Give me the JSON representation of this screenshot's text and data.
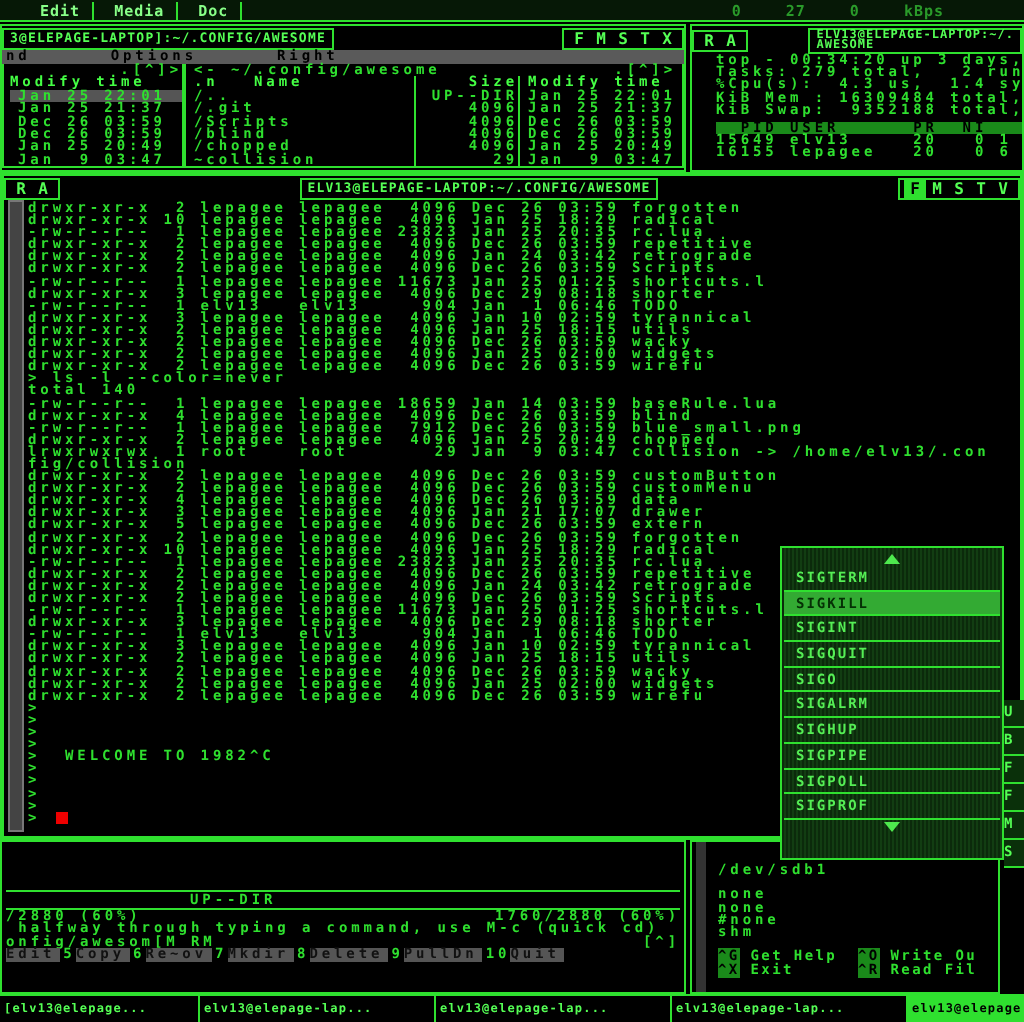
{
  "top_bar": {
    "menus": [
      {
        "label": "Edit"
      },
      {
        "label": "Media"
      },
      {
        "label": "Doc"
      }
    ],
    "indicators": [
      "0",
      "27",
      "0",
      "kBps"
    ]
  },
  "file_manager": {
    "title": "3@ELEPAGE-LAPTOP]:~/.CONFIG/AWESOME",
    "buttons": [
      "F",
      "M",
      "S",
      "T",
      "X"
    ],
    "menu": [
      "nd",
      "Options",
      "Right"
    ],
    "left_panel": {
      "header": ".[^]>",
      "column": "Modify time",
      "rows": [
        {
          "text": "Jan 25 22:01",
          "selected": true
        },
        {
          "text": "Jan 25 21:37",
          "selected": false
        },
        {
          "text": "Dec 26 03:59",
          "selected": false
        },
        {
          "text": "Dec 26 03:59",
          "selected": false
        },
        {
          "text": "Jan 25 20:49",
          "selected": false
        },
        {
          "text": "Jan  9 03:47",
          "selected": false
        }
      ]
    },
    "right_panel": {
      "path": "<- ~/.config/awesome",
      "header": ".[^]>",
      "columns": [
        ".n",
        "Name",
        "Size",
        "Modify time"
      ],
      "rows": [
        {
          "name": "/..",
          "size": "UP--DIR",
          "time": "Jan 25 22:01"
        },
        {
          "name": "/.git",
          "size": "4096",
          "time": "Jan 25 21:37"
        },
        {
          "name": "/Scripts",
          "size": "4096",
          "time": "Dec 26 03:59"
        },
        {
          "name": "/blind",
          "size": "4096",
          "time": "Dec 26 03:59"
        },
        {
          "name": "/chopped",
          "size": "4096",
          "time": "Jan 25 20:49"
        },
        {
          "name": "~collision",
          "size": "29",
          "time": "Jan  9 03:47"
        }
      ]
    }
  },
  "process_monitor": {
    "buttons": [
      "R",
      "A"
    ],
    "title": "ELV13@ELEPAGE-LAPTOP:~/.",
    "title_2": "AWESOME",
    "lines": [
      "top - 00:34:20 up 3 days,",
      "Tasks: 279 total,   2 run",
      "%Cpu(s):  4.3 us,  1.4 sy",
      "KiB Mem : 16309484 total,",
      "KiB Swap:  9352188 total,"
    ],
    "table_header": "  PID USER      PR  NI",
    "rows": [
      "15649 elv13     20   0 1",
      "16155 lepagee   20   0 6"
    ]
  },
  "terminal": {
    "buttons_left": [
      "R",
      "A"
    ],
    "title": "ELV13@ELEPAGE-LAPTOP:~/.CONFIG/AWESOME",
    "buttons_right": [
      {
        "label": "F",
        "selected": true
      },
      {
        "label": "M",
        "selected": false
      },
      {
        "label": "S",
        "selected": false
      },
      {
        "label": "T",
        "selected": false
      },
      {
        "label": "V",
        "selected": false
      }
    ],
    "lines": [
      "drwxr-xr-x  2 lepagee lepagee  4096 Dec 26 03:59 forgotten",
      "drwxr-xr-x 10 lepagee lepagee  4096 Jan 25 18:29 radical",
      "-rw-r--r--  1 lepagee lepagee 23823 Jan 25 20:35 rc.lua",
      "drwxr-xr-x  2 lepagee lepagee  4096 Dec 26 03:59 repetitive",
      "drwxr-xr-x  2 lepagee lepagee  4096 Jan 24 03:42 retrograde",
      "drwxr-xr-x  2 lepagee lepagee  4096 Dec 26 03:59 Scripts",
      "-rw-r--r--  1 lepagee lepagee 11673 Jan 25 01:25 shortcuts.l",
      "drwxr-xr-x  3 lepagee lepagee  4096 Dec 29 08:18 shorter",
      "-rw-r--r--  1 elv13   elv13     904 Jan  1 06:46 TODO",
      "drwxr-xr-x  3 lepagee lepagee  4096 Jan 10 02:59 tyrannical",
      "drwxr-xr-x  2 lepagee lepagee  4096 Jan 25 18:15 utils",
      "drwxr-xr-x  2 lepagee lepagee  4096 Dec 26 03:59 wacky",
      "drwxr-xr-x  2 lepagee lepagee  4096 Jan 25 02:00 widgets",
      "drwxr-xr-x  2 lepagee lepagee  4096 Dec 26 03:59 wirefu",
      "> ls -l --color=never",
      "total 140",
      "-rw-r--r--  1 lepagee lepagee 18659 Jan 14 03:59 baseRule.lua",
      "drwxr-xr-x  4 lepagee lepagee  4096 Dec 26 03:59 blind",
      "-rw-r--r--  1 lepagee lepagee  7912 Dec 26 03:59 blue_small.png",
      "drwxr-xr-x  2 lepagee lepagee  4096 Jan 25 20:49 chopped",
      "lrwxrwxrwx  1 root    root       29 Jan  9 03:47 collision -> /home/elv13/.con",
      "fig/collision",
      "drwxr-xr-x  2 lepagee lepagee  4096 Dec 26 03:59 customButton",
      "drwxr-xr-x  2 lepagee lepagee  4096 Dec 26 03:59 customMenu",
      "drwxr-xr-x  4 lepagee lepagee  4096 Dec 26 03:59 data",
      "drwxr-xr-x  3 lepagee lepagee  4096 Jan 21 17:07 drawer",
      "drwxr-xr-x  5 lepagee lepagee  4096 Dec 26 03:59 extern",
      "drwxr-xr-x  2 lepagee lepagee  4096 Dec 26 03:59 forgotten",
      "drwxr-xr-x 10 lepagee lepagee  4096 Jan 25 18:29 radical",
      "-rw-r--r--  1 lepagee lepagee 23823 Jan 25 20:35 rc.lua",
      "drwxr-xr-x  2 lepagee lepagee  4096 Dec 26 03:59 repetitive",
      "drwxr-xr-x  2 lepagee lepagee  4096 Jan 24 03:42 retrograde",
      "drwxr-xr-x  2 lepagee lepagee  4096 Dec 26 03:59 Scripts",
      "-rw-r--r--  1 lepagee lepagee 11673 Jan 25 01:25 shortcuts.l",
      "drwxr-xr-x  3 lepagee lepagee  4096 Dec 29 08:18 shorter",
      "-rw-r--r--  1 elv13   elv13     904 Jan  1 06:46 TODO",
      "drwxr-xr-x  3 lepagee lepagee  4096 Jan 10 02:59 tyrannical",
      "drwxr-xr-x  2 lepagee lepagee  4096 Jan 25 18:15 utils",
      "drwxr-xr-x  2 lepagee lepagee  4096 Dec 26 03:59 wacky",
      "drwxr-xr-x  2 lepagee lepagee  4096 Jan 25 02:00 widgets",
      "drwxr-xr-x  2 lepagee lepagee  4096 Dec 26 03:59 wirefu",
      ">",
      ">",
      ">",
      ">",
      ">  WELCOME TO 1982^C",
      ">",
      ">",
      ">",
      ">"
    ],
    "prompt": ">",
    "cursor": true
  },
  "file_manager_footer": {
    "panel_right_info": "UP--DIR",
    "panel_left_status": "/2880 (60%)",
    "panel_right_status": "1760/2880 (60%)",
    "hint": " halfway through typing a command, use M-c (quick cd)",
    "command_line": "onfig/awesom[M RM",
    "command_suffix": "[^]",
    "function_keys": [
      {
        "label": "Edit"
      },
      {
        "number": "5",
        "label": "Copy"
      },
      {
        "number": "6",
        "label": "Re~ov"
      },
      {
        "number": "7",
        "label": "Mkdir"
      },
      {
        "number": "8",
        "label": "Delete"
      },
      {
        "number": "9",
        "label": "PullDn"
      },
      {
        "number": "10",
        "label": "Quit"
      }
    ]
  },
  "editor": {
    "lines": [
      "/dev/sdb1",
      "none",
      "none",
      "#none",
      "shm"
    ],
    "shortcuts": [
      {
        "key": "^G",
        "label": "Get Help"
      },
      {
        "key": "^O",
        "label": "Write Ou"
      },
      {
        "key": "^X",
        "label": "Exit"
      },
      {
        "key": "^R",
        "label": "Read Fil"
      }
    ]
  },
  "signal_menu": {
    "items": [
      {
        "label": "SIGTERM",
        "selected": false
      },
      {
        "label": "SIGKILL",
        "selected": true
      },
      {
        "label": "SIGINT",
        "selected": false
      },
      {
        "label": "SIGQUIT",
        "selected": false
      },
      {
        "label": "SIGO",
        "selected": false
      },
      {
        "label": "SIGALRM",
        "selected": false
      },
      {
        "label": "SIGHUP",
        "selected": false
      },
      {
        "label": "SIGPIPE",
        "selected": false
      },
      {
        "label": "SIGPOLL",
        "selected": false
      },
      {
        "label": "SIGPROF",
        "selected": false
      }
    ]
  },
  "side_strip": [
    "U",
    "B",
    "F",
    "F",
    "M",
    "S"
  ],
  "taskbar": [
    {
      "label": "[elv13@elepage...",
      "selected": false
    },
    {
      "label": "elv13@elepage-lap...",
      "selected": false
    },
    {
      "label": "elv13@elepage-lap...",
      "selected": false
    },
    {
      "label": "elv13@elepage-lap...",
      "selected": false
    },
    {
      "label": "elv13@elepage",
      "selected": true
    }
  ]
}
